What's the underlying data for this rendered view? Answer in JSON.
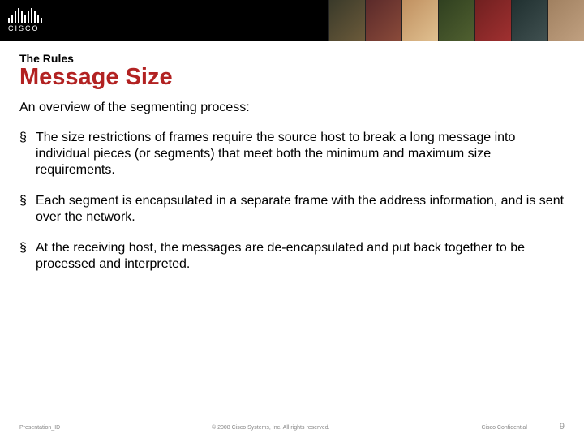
{
  "logo_text": "CISCO",
  "kicker": "The Rules",
  "title": "Message Size",
  "intro": "An overview of the segmenting process:",
  "bullets": [
    "The size restrictions of frames require the source host to break a long message into individual pieces (or segments) that meet both the minimum and maximum size requirements.",
    "Each segment is encapsulated in a separate frame with the address information, and is sent over the network.",
    "At the receiving host, the messages are de-encapsulated and put back together to be processed and interpreted."
  ],
  "footer": {
    "presentation_id": "Presentation_ID",
    "copyright": "© 2008 Cisco Systems, Inc. All rights reserved.",
    "confidential": "Cisco Confidential",
    "page_number": "9"
  }
}
